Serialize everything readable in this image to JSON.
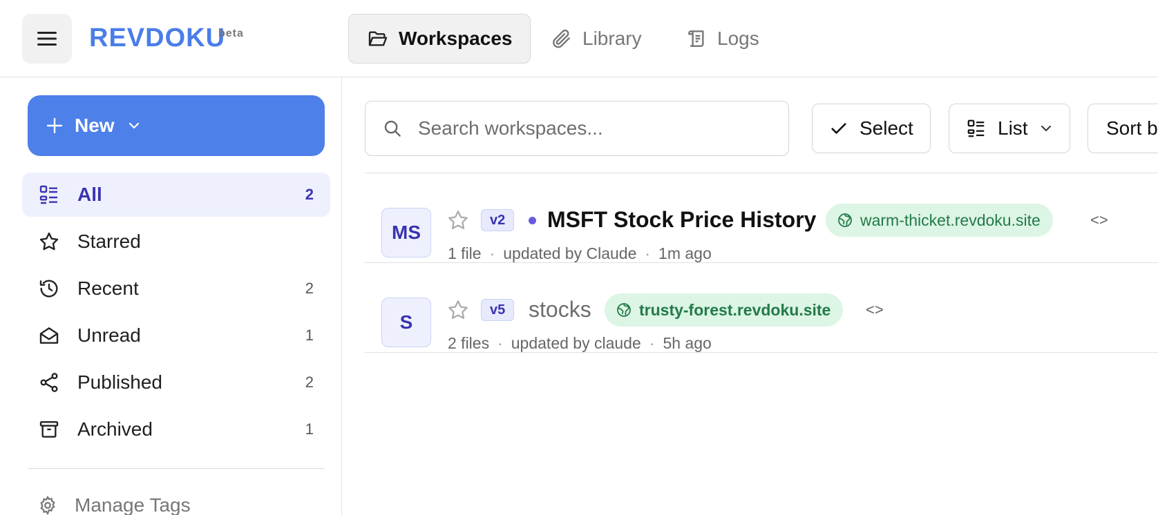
{
  "header": {
    "brand": "REVDOKU",
    "brand_tag": "beta",
    "tabs": [
      {
        "label": "Workspaces",
        "icon": "folder-open-icon",
        "active": true
      },
      {
        "label": "Library",
        "icon": "paperclip-icon",
        "active": false
      },
      {
        "label": "Logs",
        "icon": "scroll-icon",
        "active": false
      }
    ]
  },
  "sidebar": {
    "new_label": "New",
    "items": [
      {
        "label": "All",
        "count": "2",
        "icon": "list-grid-icon",
        "active": true
      },
      {
        "label": "Starred",
        "count": "",
        "icon": "star-icon",
        "active": false
      },
      {
        "label": "Recent",
        "count": "2",
        "icon": "history-icon",
        "active": false
      },
      {
        "label": "Unread",
        "count": "1",
        "icon": "envelope-open-icon",
        "active": false
      },
      {
        "label": "Published",
        "count": "2",
        "icon": "share-icon",
        "active": false
      },
      {
        "label": "Archived",
        "count": "1",
        "icon": "archive-icon",
        "active": false
      }
    ],
    "manage_tags": "Manage Tags"
  },
  "toolbar": {
    "search_placeholder": "Search workspaces...",
    "select_label": "Select",
    "view_label": "List",
    "sort_label": "Sort b"
  },
  "workspaces": [
    {
      "initials": "MS",
      "version": "v2",
      "unread": true,
      "title": "MSFT Stock Price History",
      "site": "warm-thicket.revdoku.site",
      "files": "1 file",
      "updated_by": "updated by Claude",
      "time": "1m ago"
    },
    {
      "initials": "S",
      "version": "v5",
      "unread": false,
      "title": "stocks",
      "site": "trusty-forest.revdoku.site",
      "files": "2 files",
      "updated_by": "updated by claude",
      "time": "5h ago"
    }
  ],
  "colors": {
    "accent": "#4e80ea",
    "brand": "#4a7de8",
    "active_text": "#3b33b0",
    "site_bg": "#dcf5e4",
    "site_text": "#237a49"
  }
}
